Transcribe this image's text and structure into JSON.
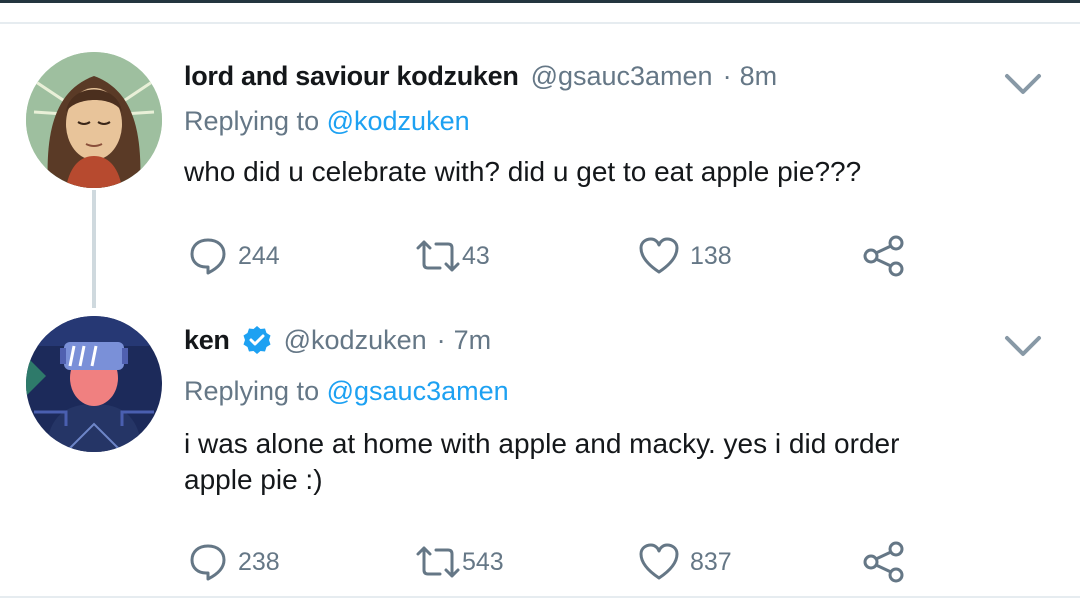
{
  "tweets": [
    {
      "display_name": "lord and saviour kodzuken",
      "handle": "@gsauc3amen",
      "separator": "·",
      "time": "8m",
      "verified": false,
      "replying_prefix": "Replying to",
      "replying_to": "@kodzuken",
      "text": "who did u celebrate with? did u get to eat apple pie???",
      "counts": {
        "replies": "244",
        "retweets": "43",
        "likes": "138"
      }
    },
    {
      "display_name": "ken",
      "handle": "@kodzuken",
      "separator": "·",
      "time": "7m",
      "verified": true,
      "replying_prefix": "Replying to",
      "replying_to": "@gsauc3amen",
      "text": "i was alone at home with apple and macky. yes i did order apple pie :)",
      "counts": {
        "replies": "238",
        "retweets": "543",
        "likes": "837"
      }
    }
  ],
  "icons": {
    "reply": "speech-bubble-icon",
    "retweet": "retweet-arrows-icon",
    "like": "heart-icon",
    "share": "share-nodes-icon",
    "menu": "chevron-down-icon",
    "verified": "verified-badge-icon"
  },
  "colors": {
    "link": "#1da1f2",
    "secondary_text": "#657786",
    "primary_text": "#14171a",
    "verified": "#1da1f2",
    "divider": "#e6ecf0"
  }
}
